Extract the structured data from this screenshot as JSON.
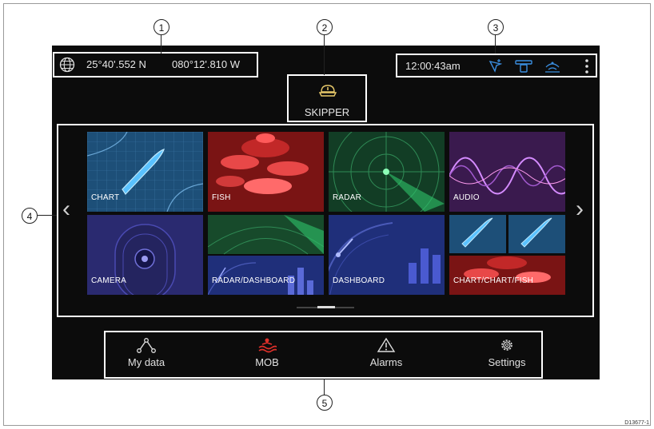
{
  "status_bar": {
    "latitude": "25°40'.552 N",
    "longitude": "080°12'.810 W",
    "time": "12:00:43am",
    "icons": [
      "globe-icon",
      "gps-icon",
      "transducer-icon",
      "sonar-icon",
      "more-icon"
    ]
  },
  "profile": {
    "name": "SKIPPER",
    "icon": "captain-hat-icon"
  },
  "apps": [
    {
      "label": "CHART"
    },
    {
      "label": "FISH"
    },
    {
      "label": "RADAR"
    },
    {
      "label": "AUDIO"
    },
    {
      "label": "CAMERA"
    },
    {
      "label": "RADAR/DASHBOARD"
    },
    {
      "label": "DASHBOARD"
    },
    {
      "label": "CHART/CHART/FISH"
    }
  ],
  "page_indicator": {
    "current": 1,
    "total": 2
  },
  "bottom_nav": [
    {
      "label": "My data",
      "icon": "data-nodes-icon"
    },
    {
      "label": "MOB",
      "icon": "man-overboard-icon"
    },
    {
      "label": "Alarms",
      "icon": "warning-icon"
    },
    {
      "label": "Settings",
      "icon": "gear-icon"
    }
  ],
  "callouts": [
    "1",
    "2",
    "3",
    "4",
    "5"
  ],
  "reference_code": "D13677-1",
  "colors": {
    "screen_bg": "#0c0c0c",
    "mob_red": "#e0302a",
    "accent_blue": "#3a8ee0"
  }
}
